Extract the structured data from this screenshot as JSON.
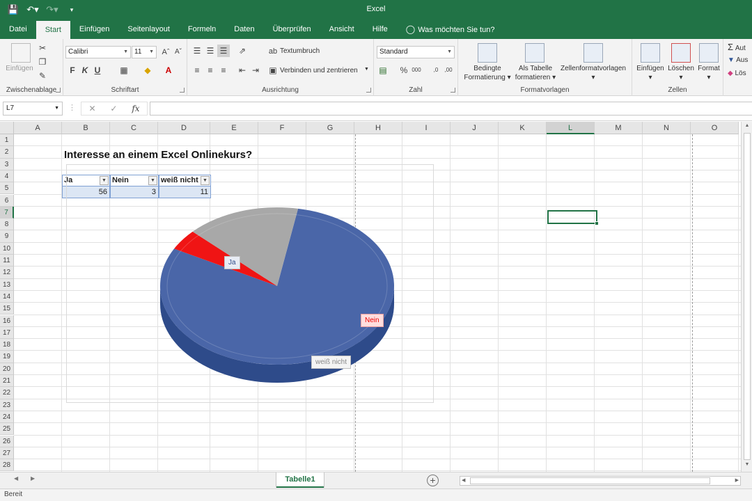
{
  "app": {
    "title": "Excel"
  },
  "tabs": [
    "Datei",
    "Start",
    "Einfügen",
    "Seitenlayout",
    "Formeln",
    "Daten",
    "Überprüfen",
    "Ansicht",
    "Hilfe"
  ],
  "tell_me": "Was möchten Sie tun?",
  "ribbon": {
    "clipboard": {
      "label": "Zwischenablage",
      "paste": "Einfügen"
    },
    "font": {
      "label": "Schriftart",
      "name": "Calibri",
      "size": "11",
      "bold": "F",
      "italic": "K",
      "underline": "U"
    },
    "alignment": {
      "label": "Ausrichtung",
      "wrap": "Textumbruch",
      "merge": "Verbinden und zentrieren"
    },
    "number": {
      "label": "Zahl",
      "format": "Standard",
      "percent": "%",
      "thousands": "000"
    },
    "styles": {
      "label": "Formatvorlagen",
      "conditional_1": "Bedingte",
      "conditional_2": "Formatierung",
      "table_1": "Als Tabelle",
      "table_2": "formatieren",
      "cell_styles": "Zellenformatvorlagen"
    },
    "cells": {
      "label": "Zellen",
      "insert": "Einfügen",
      "delete": "Löschen",
      "format": "Format"
    },
    "editing": {
      "autosum": "Aut",
      "fill": "Aus",
      "clear": "Lös"
    }
  },
  "formula_bar": {
    "name_box": "L7",
    "content": ""
  },
  "columns": [
    "A",
    "B",
    "C",
    "D",
    "E",
    "F",
    "G",
    "H",
    "I",
    "J",
    "K",
    "L",
    "M",
    "N",
    "O"
  ],
  "rows": [
    "1",
    "2",
    "3",
    "4",
    "5",
    "6",
    "7",
    "8",
    "9",
    "10",
    "11",
    "12",
    "13",
    "14",
    "15",
    "16",
    "17",
    "18",
    "19",
    "20",
    "21",
    "22",
    "23",
    "24",
    "25",
    "26",
    "27",
    "28"
  ],
  "selected": {
    "column": "L",
    "row": "7"
  },
  "sheet": {
    "title": "Interesse an einem Excel Onlinekurs?",
    "table_headers": [
      "Ja",
      "Nein",
      "weiß nicht"
    ],
    "table_values": [
      "56",
      "3",
      "11"
    ]
  },
  "chart_data": {
    "type": "pie",
    "categories": [
      "Ja",
      "Nein",
      "weiß nicht"
    ],
    "values": [
      56,
      3,
      11
    ],
    "colors": [
      "#4a66a8",
      "#f01414",
      "#a8a8a8"
    ],
    "side_colors": [
      "#2e4b8a",
      "#b80c0c",
      "#878787"
    ],
    "labels": [
      "Ja",
      "Nein",
      "weiß nicht"
    ],
    "title": "",
    "legend": "none"
  },
  "sheet_tabs": [
    "Tabelle1"
  ],
  "status": "Bereit"
}
